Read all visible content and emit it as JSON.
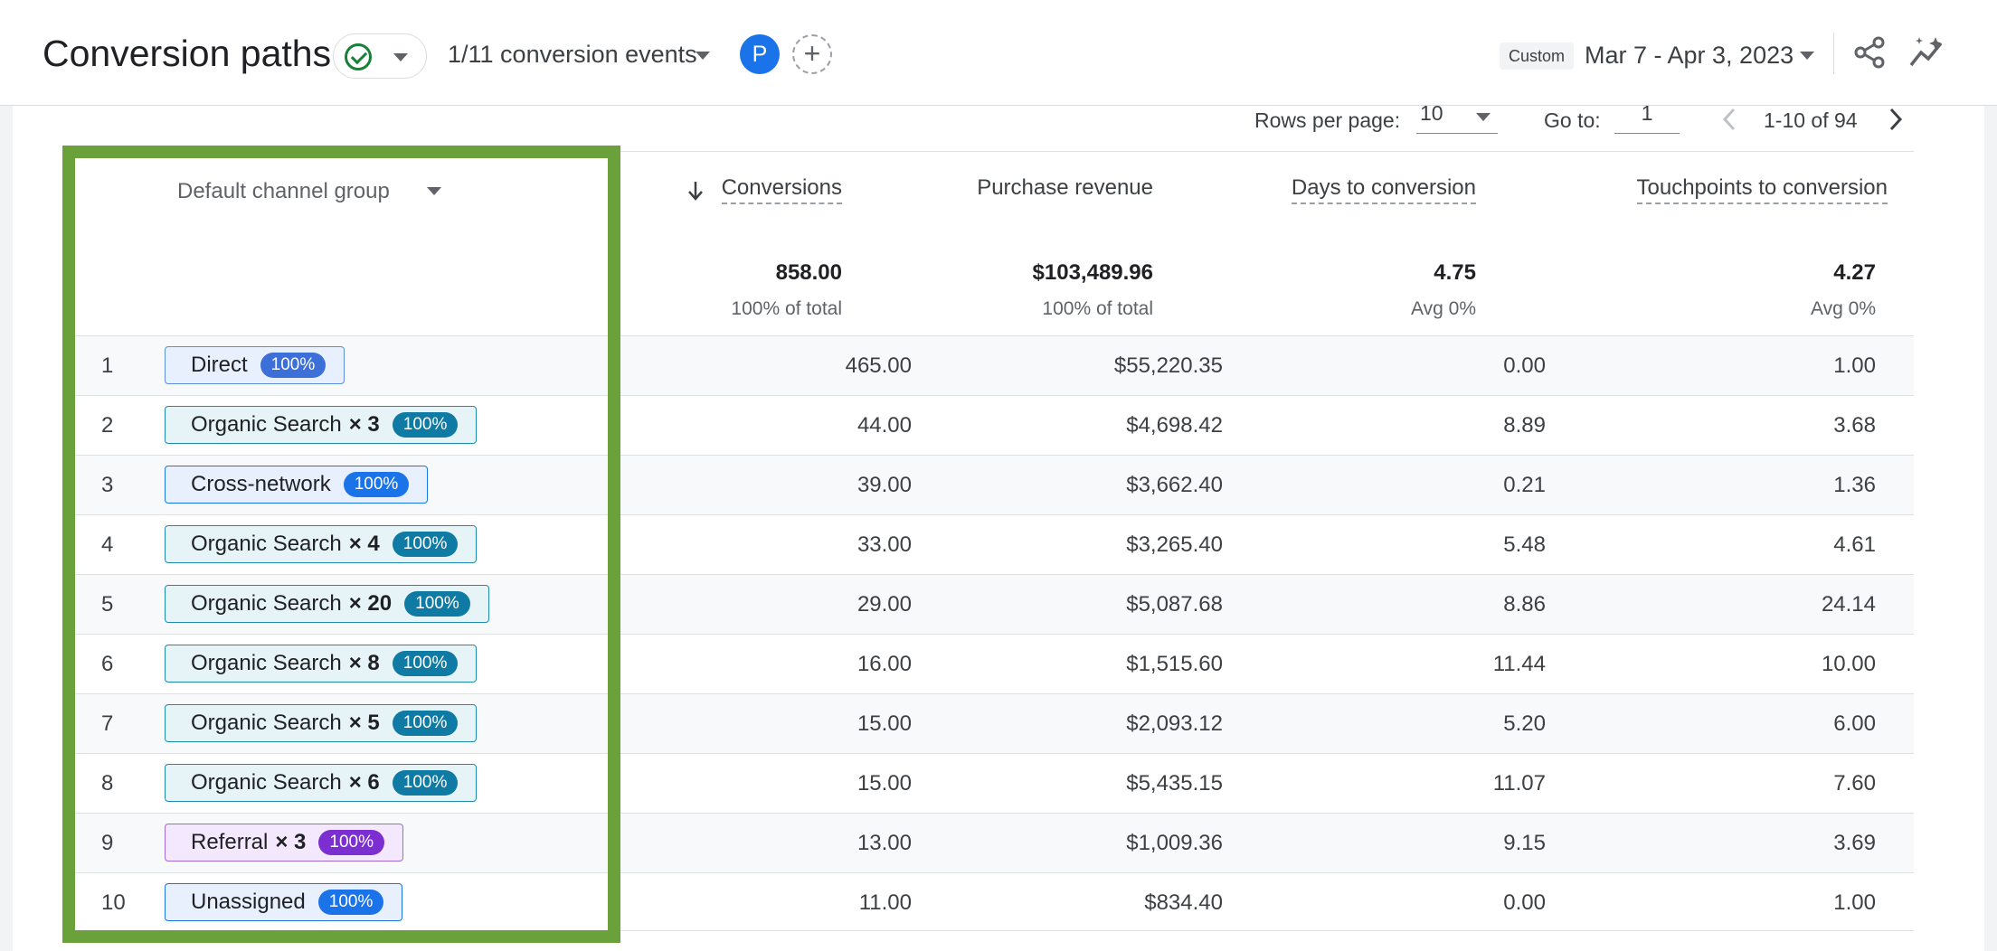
{
  "header": {
    "title": "Conversion paths",
    "events_label": "1/11 conversion events",
    "avatar_letter": "P",
    "add_symbol": "+",
    "custom_label": "Custom",
    "date_range": "Mar 7 - Apr 3, 2023"
  },
  "pagination": {
    "rows_per_page_label": "Rows per page:",
    "rows_per_page_value": "10",
    "goto_label": "Go to:",
    "goto_value": "1",
    "range_label": "1-10 of 94"
  },
  "table": {
    "dimension_header": "Default channel group",
    "columns": [
      "Conversions",
      "Purchase revenue",
      "Days to conversion",
      "Touchpoints to conversion"
    ],
    "totals": [
      "858.00",
      "$103,489.96",
      "4.75",
      "4.27"
    ],
    "totals_sub": [
      "100% of total",
      "100% of total",
      "Avg 0%",
      "Avg 0%"
    ],
    "rows": [
      {
        "num": "1",
        "channel": "Direct",
        "count": "",
        "badge": "100%",
        "type": "direct",
        "values": [
          "465.00",
          "$55,220.35",
          "0.00",
          "1.00"
        ]
      },
      {
        "num": "2",
        "channel": "Organic Search",
        "count": "× 3",
        "badge": "100%",
        "type": "organic",
        "values": [
          "44.00",
          "$4,698.42",
          "8.89",
          "3.68"
        ]
      },
      {
        "num": "3",
        "channel": "Cross-network",
        "count": "",
        "badge": "100%",
        "type": "cross",
        "values": [
          "39.00",
          "$3,662.40",
          "0.21",
          "1.36"
        ]
      },
      {
        "num": "4",
        "channel": "Organic Search",
        "count": "× 4",
        "badge": "100%",
        "type": "organic",
        "values": [
          "33.00",
          "$3,265.40",
          "5.48",
          "4.61"
        ]
      },
      {
        "num": "5",
        "channel": "Organic Search",
        "count": "× 20",
        "badge": "100%",
        "type": "organic",
        "values": [
          "29.00",
          "$5,087.68",
          "8.86",
          "24.14"
        ]
      },
      {
        "num": "6",
        "channel": "Organic Search",
        "count": "× 8",
        "badge": "100%",
        "type": "organic",
        "values": [
          "16.00",
          "$1,515.60",
          "11.44",
          "10.00"
        ]
      },
      {
        "num": "7",
        "channel": "Organic Search",
        "count": "× 5",
        "badge": "100%",
        "type": "organic",
        "values": [
          "15.00",
          "$2,093.12",
          "5.20",
          "6.00"
        ]
      },
      {
        "num": "8",
        "channel": "Organic Search",
        "count": "× 6",
        "badge": "100%",
        "type": "organic",
        "values": [
          "15.00",
          "$5,435.15",
          "11.07",
          "7.60"
        ]
      },
      {
        "num": "9",
        "channel": "Referral",
        "count": "× 3",
        "badge": "100%",
        "type": "referral",
        "values": [
          "13.00",
          "$1,009.36",
          "9.15",
          "3.69"
        ]
      },
      {
        "num": "10",
        "channel": "Unassigned",
        "count": "",
        "badge": "100%",
        "type": "unassigned",
        "values": [
          "11.00",
          "$834.40",
          "0.00",
          "1.00"
        ]
      }
    ]
  },
  "colors": {
    "highlight_border": "#6aa13a",
    "accent_blue": "#1a73e8",
    "status_green": "#188038"
  }
}
